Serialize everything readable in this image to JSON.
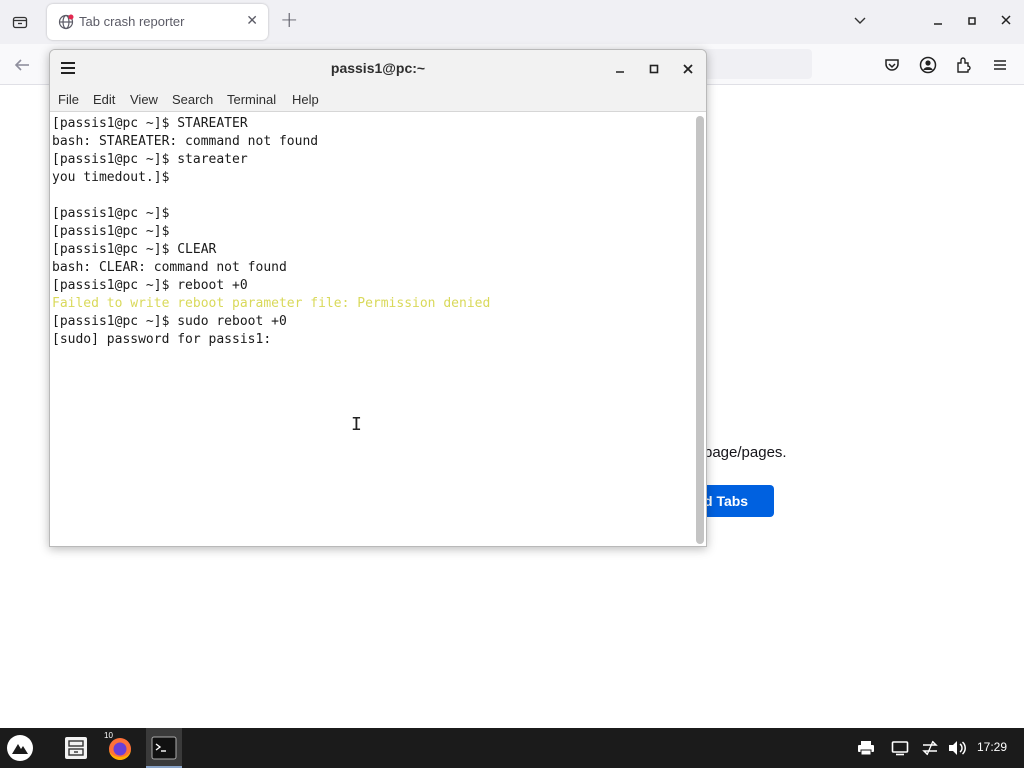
{
  "browser": {
    "tab_title": "Tab crash reporter",
    "page_text_fragment": "page/pages.",
    "page_button_fragment": "d Tabs"
  },
  "terminal": {
    "title": "passis1@pc:~",
    "menu": [
      "File",
      "Edit",
      "View",
      "Search",
      "Terminal",
      "Help"
    ],
    "lines": [
      {
        "text": "[passis1@pc ~]$ STAREATER",
        "style": "normal"
      },
      {
        "text": "bash: STAREATER: command not found",
        "style": "normal"
      },
      {
        "text": "[passis1@pc ~]$ stareater",
        "style": "normal"
      },
      {
        "text": "you timedout.]$",
        "style": "normal"
      },
      {
        "text": "",
        "style": "normal"
      },
      {
        "text": "[passis1@pc ~]$",
        "style": "normal"
      },
      {
        "text": "[passis1@pc ~]$",
        "style": "normal"
      },
      {
        "text": "[passis1@pc ~]$ CLEAR",
        "style": "normal"
      },
      {
        "text": "bash: CLEAR: command not found",
        "style": "normal"
      },
      {
        "text": "[passis1@pc ~]$ reboot +0",
        "style": "normal"
      },
      {
        "text": "Failed to write reboot parameter file: Permission denied",
        "style": "warn"
      },
      {
        "text": "[passis1@pc ~]$ sudo reboot +0",
        "style": "normal"
      },
      {
        "text": "[sudo] password for passis1:",
        "style": "normal"
      }
    ]
  },
  "taskbar": {
    "firefox_badge": "10",
    "clock": "17:29"
  },
  "colors": {
    "warn_text": "#d9d95a",
    "accent_button": "#0061e0",
    "taskbar_bg": "#1b1b1b"
  },
  "icons": [
    "tab-list-icon",
    "globe-icon",
    "close-icon",
    "plus-icon",
    "chevron-down-icon",
    "minimize-icon",
    "maximize-icon",
    "back-arrow-icon",
    "pocket-icon",
    "account-icon",
    "extensions-icon",
    "menu-icon",
    "hamburger-icon",
    "system-menu-icon",
    "file-manager-icon",
    "firefox-icon",
    "terminal-icon",
    "printer-icon",
    "display-icon",
    "network-icon",
    "volume-icon"
  ]
}
